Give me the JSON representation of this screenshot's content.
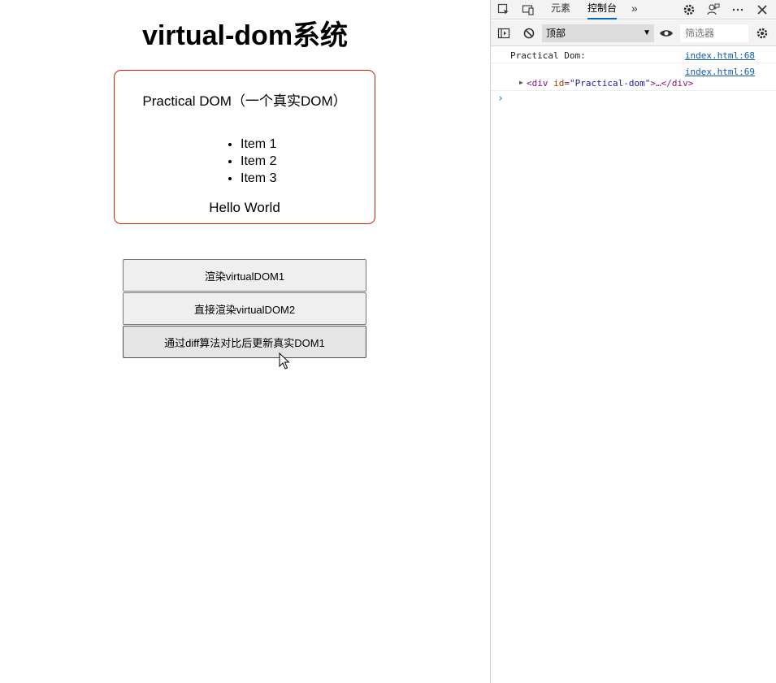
{
  "page": {
    "title": "virtual-dom系统",
    "dom_box": {
      "heading": "Practical DOM（一个真实DOM）",
      "items": [
        "Item 1",
        "Item 2",
        "Item 3"
      ],
      "footer": "Hello World"
    },
    "buttons": {
      "render1": "渲染virtualDOM1",
      "render2": "直接渲染virtualDOM2",
      "diff_update": "通过diff算法对比后更新真实DOM1"
    }
  },
  "devtools": {
    "tabs": {
      "elements": "元素",
      "console": "控制台",
      "more": "»"
    },
    "toolbar": {
      "context": "顶部",
      "filter_placeholder": "筛选器"
    },
    "logs": [
      {
        "message": "Practical Dom:",
        "source": "index.html:68"
      },
      {
        "message_tag_open": "<div ",
        "message_attr": "id",
        "message_eq": "=",
        "message_val": "\"Practical-dom\"",
        "message_rest": ">…</div>",
        "source": "index.html:69"
      }
    ],
    "prompt": "›"
  },
  "colors": {
    "box_border": "#cc2200",
    "link": "#1558b0",
    "tab_active": "#0067c0"
  }
}
